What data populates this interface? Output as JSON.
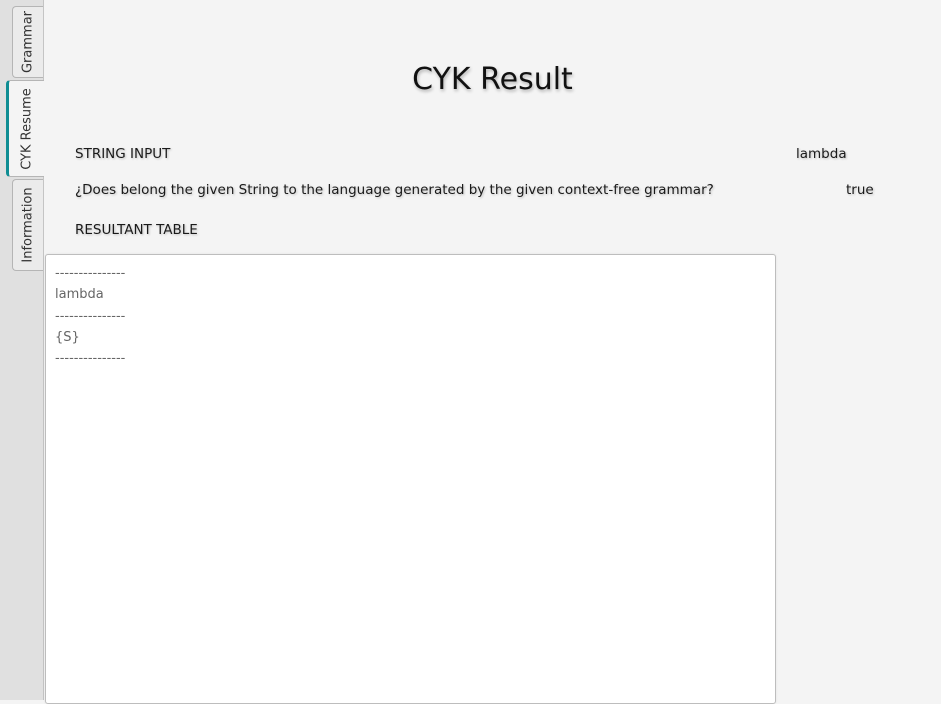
{
  "tabs": [
    {
      "label": "Grammar"
    },
    {
      "label": "CYK Resume"
    },
    {
      "label": "Information"
    }
  ],
  "page_title": "CYK Result",
  "string_input": {
    "label": "STRING INPUT",
    "value": "lambda"
  },
  "membership": {
    "question": "¿Does belong the given String to the language generated by the given context-free grammar?",
    "answer": "true"
  },
  "resultant_table": {
    "label": "RESULTANT TABLE",
    "lines": [
      "---------------",
      "lambda",
      "---------------",
      "{S}",
      "---------------"
    ]
  },
  "colors": {
    "accent": "#0f8d93",
    "background": "#f4f4f4"
  }
}
